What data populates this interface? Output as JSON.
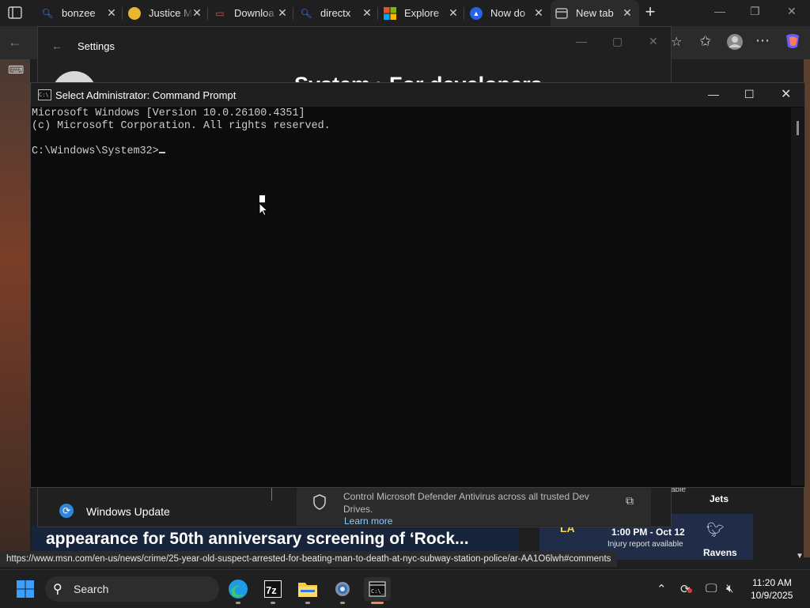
{
  "browser": {
    "tabs": [
      {
        "title": "bonzee",
        "icon": "search-icon",
        "icon_color": "#3b82f6"
      },
      {
        "title": "Justice M",
        "icon": "chrome-icon",
        "icon_color": "#f5c542"
      },
      {
        "title": "Downloa",
        "icon": "pdf-icon",
        "icon_color": "#e05050"
      },
      {
        "title": "directx",
        "icon": "search-icon",
        "icon_color": "#3b82f6"
      },
      {
        "title": "Explore",
        "icon": "microsoft-icon",
        "icon_color": "#f25022"
      },
      {
        "title": "Now do",
        "icon": "arrow-icon",
        "icon_color": "#3b82f6"
      },
      {
        "title": "New tab",
        "icon": "newtab-page-icon",
        "icon_color": "#cfcfcf",
        "active": true
      }
    ],
    "status_url": "https://www.msn.com/en-us/news/crime/25-year-old-suspect-arrested-for-beating-man-to-death-at-nyc-subway-station-police/ar-AA1O6lwh#comments",
    "headline": "appearance for 50th anniversary screening of ‘Rock...",
    "sports": {
      "time": "1:00 PM - Oct 12",
      "subtitle": "Injury report available",
      "team1": "Jets",
      "team2": "Ravens",
      "team2_partial_label": "able"
    }
  },
  "settings": {
    "title": "Settings",
    "heading": "System  ›  For developers",
    "windows_update_label": "Windows Update",
    "defender_text": "Control Microsoft Defender Antivirus across all trusted Dev Drives.",
    "learn_more": "Learn more"
  },
  "cmd": {
    "title": "Select Administrator: Command Prompt",
    "line1": "Microsoft Windows [Version 10.0.26100.4351]",
    "line2": "(c) Microsoft Corporation. All rights reserved.",
    "line3": "",
    "prompt": "C:\\Windows\\System32>"
  },
  "taskbar": {
    "search_placeholder": "Search",
    "time": "11:20 AM",
    "date": "10/9/2025",
    "apps": [
      "edge-icon",
      "7zip-icon",
      "file-explorer-icon",
      "settings-gear-icon",
      "terminal-icon"
    ],
    "accent_color": "#f08a4b"
  }
}
